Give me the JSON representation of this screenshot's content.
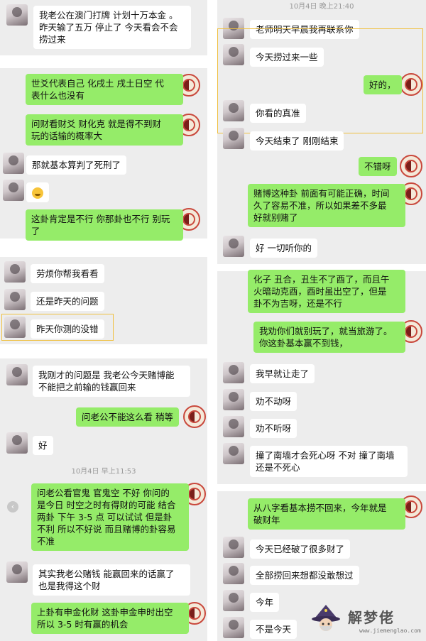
{
  "left_chat": [
    {
      "side": "left",
      "text": "我老公在澳门打牌 计划十万本金 。\n昨天输了五万 停止了 今天看会不会\n捞过来"
    },
    {
      "side": "right",
      "text": "世爻代表自己 化戌土 戌土日空 代\n表什么也没有"
    },
    {
      "side": "right",
      "text": "问财看财爻 财化克 就是得不到财\n玩的话输的概率大"
    },
    {
      "side": "left",
      "text": "那就基本算判了死刑了"
    },
    {
      "side": "left",
      "text": "",
      "emoji": "sweat-smile-emoji"
    },
    {
      "side": "right",
      "text": "这卦肯定是不行 你那卦也不行 别玩\n了"
    },
    {
      "side": "left",
      "text": "劳烦你帮我看看"
    },
    {
      "side": "left",
      "text": "还是昨天的问题"
    },
    {
      "side": "left",
      "text": "昨天你测的没错"
    },
    {
      "side": "left",
      "text": "我刚才的问题是 我老公今天赌博能\n不能把之前输的钱赢回来"
    },
    {
      "side": "right",
      "text": "问老公不能这么看 稍等"
    },
    {
      "side": "left",
      "text": "好"
    },
    {
      "side": "time",
      "text": "10月4日 早上11:53"
    },
    {
      "side": "right",
      "text": "问老公看官鬼 官鬼空 不好 你问的\n是今日 时空之时有得财的可能 结合\n两卦 下午 3-5 点 可以试试 但是卦\n不利 所以不好说 而且赌博的卦容易\n不准"
    },
    {
      "side": "left",
      "text": "其实我老公赌钱 能赢回来的话赢了\n也是我得这个财"
    },
    {
      "side": "right",
      "text": "上卦有申金化财 这卦申金申时出空\n所以 3-5 时有赢的机会"
    }
  ],
  "right_chat": [
    {
      "side": "time",
      "text": "10月4日 晚上21:40"
    },
    {
      "side": "left",
      "text": "老师明天早晨我再联系你"
    },
    {
      "side": "left",
      "text": "今天捞过来一些"
    },
    {
      "side": "right",
      "text": "好的，"
    },
    {
      "side": "left",
      "text": "你看的真准"
    },
    {
      "side": "left",
      "text": "今天结束了 刚刚结束"
    },
    {
      "side": "right",
      "text": "不错呀"
    },
    {
      "side": "right",
      "text": "赌博这种卦 前面有可能正确，时间\n久了容易不准，所以如果差不多最\n好就别赌了"
    },
    {
      "side": "left",
      "text": "好 一切听你的"
    },
    {
      "side": "right",
      "text": "化子 丑合，丑生不了酉了，而且午\n火暗动克酉，酉时虽出空了，但是\n卦不为吉呀，还是不行"
    },
    {
      "side": "right",
      "text": "我劝你们就别玩了，就当旅游了。\n你这卦基本赢不到钱，"
    },
    {
      "side": "left",
      "text": "我早就让走了"
    },
    {
      "side": "left",
      "text": "劝不动呀"
    },
    {
      "side": "left",
      "text": "劝不听呀"
    },
    {
      "side": "left",
      "text": "撞了南墙才会死心呀 不对 撞了南墙\n还是不死心"
    },
    {
      "side": "right",
      "text": "从八字看基本捞不回来，今年就是\n破财年"
    },
    {
      "side": "left",
      "text": "今天已经破了很多财了"
    },
    {
      "side": "left",
      "text": "全部捞回来想都没敢想过"
    },
    {
      "side": "left",
      "text": "今年"
    },
    {
      "side": "left",
      "text": "不是今天"
    }
  ],
  "watermark": {
    "name": "解梦佬",
    "url": "www.jiemenglao.com"
  }
}
